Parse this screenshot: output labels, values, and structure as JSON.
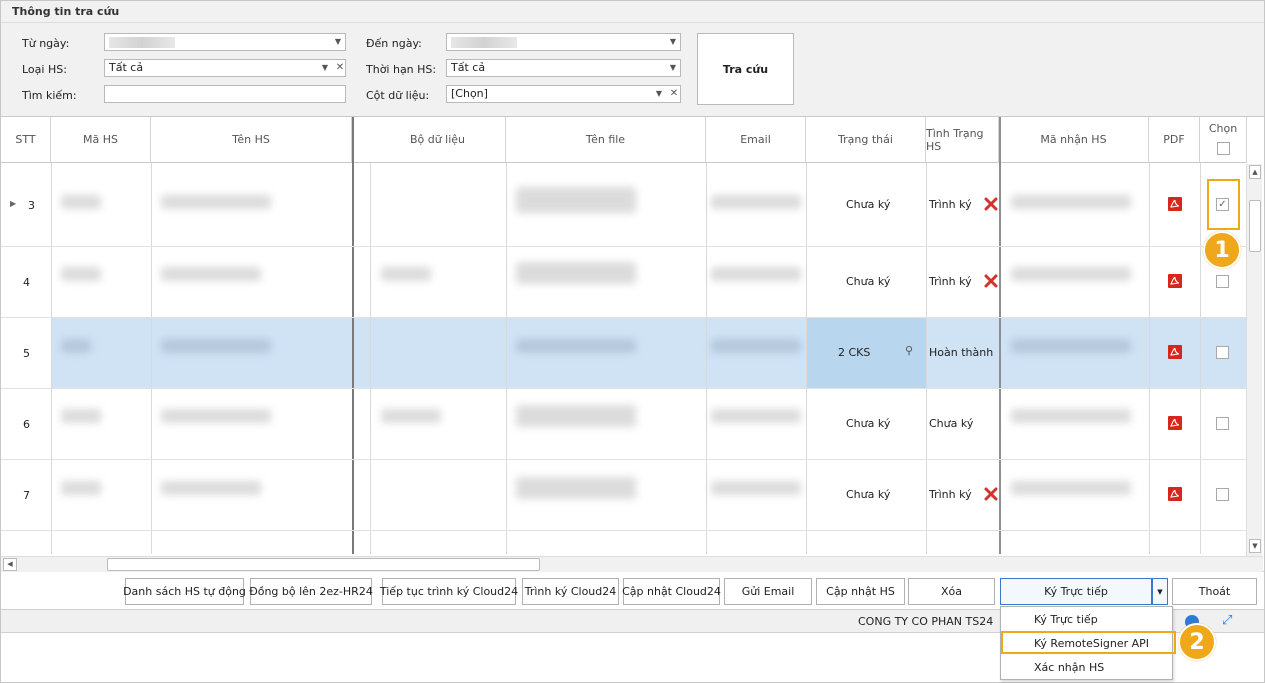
{
  "search_panel": {
    "title": "Thông tin tra cứu",
    "from_date_label": "Từ ngày:",
    "to_date_label": "Đến ngày:",
    "doc_type_label": "Loại HS:",
    "doc_type_value": "Tất cả",
    "deadline_label": "Thời hạn HS:",
    "deadline_value": "Tất cả",
    "search_label": "Tìm kiếm:",
    "search_value": "",
    "column_label": "Cột dữ liệu:",
    "column_value": "[Chọn]",
    "search_button": "Tra cứu"
  },
  "grid": {
    "columns": [
      "STT",
      "Mã HS",
      "Tên HS",
      "Bộ dữ liệu",
      "Tên file",
      "Email",
      "Trạng thái",
      "Tình Trạng HS",
      "Mã nhận HS",
      "PDF",
      "Chọn"
    ],
    "rows": [
      {
        "stt": "3",
        "status": "Chưa ký",
        "doc_state": "Trình ký",
        "rejected": true,
        "checked": true,
        "current": true
      },
      {
        "stt": "4",
        "status": "Chưa ký",
        "doc_state": "Trình ký",
        "rejected": true,
        "checked": false
      },
      {
        "stt": "5",
        "status": "2 CKS",
        "doc_state": "Hoàn thành",
        "rejected": false,
        "checked": false,
        "selected": true
      },
      {
        "stt": "6",
        "status": "Chưa ký",
        "doc_state": "Chưa ký",
        "rejected": false,
        "checked": false
      },
      {
        "stt": "7",
        "status": "Chưa ký",
        "doc_state": "Trình ký",
        "rejected": true,
        "checked": false
      }
    ]
  },
  "toolbar": {
    "auto_list": "Danh sách HS tự động",
    "sync": "Đồng bộ lên 2ez-HR24",
    "continue_cloud": "Tiếp tục trình ký Cloud24",
    "submit_cloud": "Trình ký Cloud24",
    "update_cloud": "Cập nhật Cloud24",
    "send_email": "Gửi Email",
    "update_hs": "Cập nhật HS",
    "delete": "Xóa",
    "sign_direct": "Ký Trực tiếp",
    "exit": "Thoát"
  },
  "status_bar": {
    "company": "CONG TY CO PHAN TS24"
  },
  "dropdown_menu": {
    "items": [
      "Ký Trực tiếp",
      "Ký RemoteSigner API",
      "Xác nhận HS"
    ]
  },
  "annotations": {
    "badge1": "1",
    "badge2": "2",
    "highlight_color": "#f0a81b"
  },
  "colors": {
    "selected_row": "#cfe3f5",
    "pdf_red": "#d9261c",
    "reject_red": "#d0342c"
  }
}
